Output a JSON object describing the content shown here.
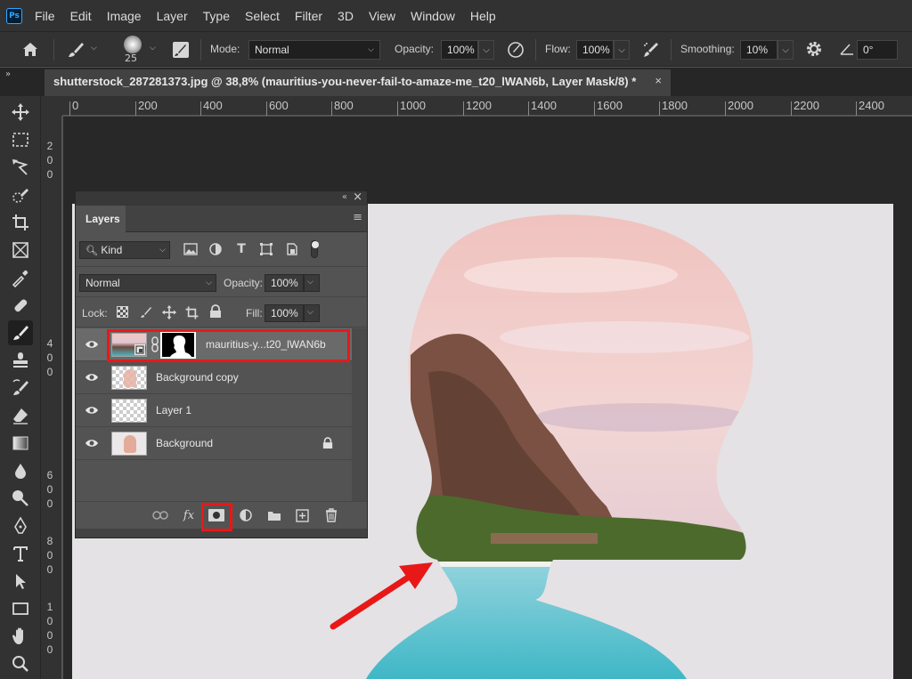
{
  "app": {
    "logo": "Ps"
  },
  "menu": [
    "File",
    "Edit",
    "Image",
    "Layer",
    "Type",
    "Select",
    "Filter",
    "3D",
    "View",
    "Window",
    "Help"
  ],
  "options": {
    "brush_size": "25",
    "mode_label": "Mode:",
    "mode_value": "Normal",
    "opacity_label": "Opacity:",
    "opacity_value": "100%",
    "flow_label": "Flow:",
    "flow_value": "100%",
    "smoothing_label": "Smoothing:",
    "smoothing_value": "10%",
    "angle_value": "0°"
  },
  "document_tab": {
    "title": "shutterstock_287281373.jpg @ 38,8% (mauritius-you-never-fail-to-amaze-me_t20_lWAN6b, Layer Mask/8) *",
    "close": "×"
  },
  "ruler_top": [
    "0",
    "200",
    "400",
    "600",
    "800",
    "1000",
    "1200",
    "1400",
    "1600",
    "1800",
    "2000",
    "2200",
    "2400"
  ],
  "ruler_left": [
    "2",
    "0",
    "0",
    "4",
    "0",
    "0",
    "6",
    "0",
    "0",
    "8",
    "0",
    "0",
    "1",
    "0",
    "0",
    "0"
  ],
  "layers_panel": {
    "tab": "Layers",
    "kind_label": "Kind",
    "blend_mode": "Normal",
    "opacity_label": "Opacity:",
    "opacity_value": "100%",
    "lock_label": "Lock:",
    "fill_label": "Fill:",
    "fill_value": "100%",
    "layers": [
      {
        "name": "mauritius-y...t20_lWAN6b",
        "selected": true,
        "has_mask": true
      },
      {
        "name": "Background copy",
        "selected": false
      },
      {
        "name": "Layer 1",
        "selected": false
      },
      {
        "name": "Background",
        "selected": false,
        "locked": true
      }
    ],
    "bottom_fx": "fx"
  },
  "colors": {
    "highlight": "#e81818",
    "panel": "#535353",
    "workspace": "#282828"
  }
}
